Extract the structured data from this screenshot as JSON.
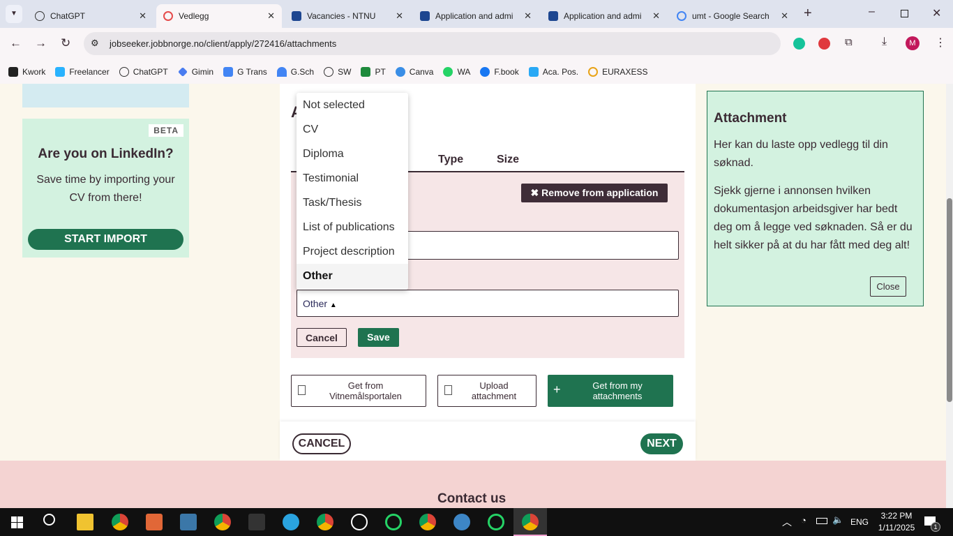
{
  "browser": {
    "tabs": [
      {
        "title": "ChatGPT",
        "active": false
      },
      {
        "title": "Vedlegg",
        "active": true
      },
      {
        "title": "Vacancies - NTNU",
        "active": false
      },
      {
        "title": "Application and admi",
        "active": false
      },
      {
        "title": "Application and admi",
        "active": false
      },
      {
        "title": "umt - Google Search",
        "active": false
      }
    ],
    "url": "jobseeker.jobbnorge.no/client/apply/272416/attachments",
    "profile_initial": "M",
    "bookmarks": [
      "Kwork",
      "Freelancer",
      "ChatGPT",
      "Gimin",
      "G Trans",
      "G.Sch",
      "SW",
      "PT",
      "Canva",
      "WA",
      "F.book",
      "Aca. Pos.",
      "EURAXESS"
    ]
  },
  "sidebar": {
    "beta": "BETA",
    "linkedin_title": "Are you on LinkedIn?",
    "linkedin_text": "Save time by importing your CV from there!",
    "import_button": "START IMPORT"
  },
  "main": {
    "table_headers": {
      "type": "Type",
      "size": "Size"
    },
    "remove_button": "Remove from application",
    "type_select_value": "Other",
    "type_options": [
      "Not selected",
      "CV",
      "Diploma",
      "Testimonial",
      "Task/Thesis",
      "List of publications",
      "Project description",
      "Other"
    ],
    "selected_option": "Other",
    "cancel": "Cancel",
    "save": "Save",
    "get_vitnemal": "Get from Vitnemålsportalen",
    "upload": "Upload attachment",
    "get_mine": "Get from my attachments",
    "nav_cancel": "CANCEL",
    "nav_next": "NEXT"
  },
  "help": {
    "title": "Attachment",
    "p1": "Her kan du laste opp vedlegg til din søknad.",
    "p2": "Sjekk gjerne i annonsen hvilken dokumentasjon arbeidsgiver har bedt deg om å legge ved søknaden. Så er du helt sikker på at du har fått med deg alt!",
    "close": "Close"
  },
  "footer": {
    "contact": "Contact us"
  },
  "taskbar": {
    "lang": "ENG",
    "time": "3:22 PM",
    "date": "1/11/2025",
    "notifications": "1"
  },
  "colors": {
    "accent_green": "#1f7350",
    "dark": "#3a2a33",
    "row_bg": "#f6e6e7",
    "help_bg": "#d3f2e0"
  }
}
